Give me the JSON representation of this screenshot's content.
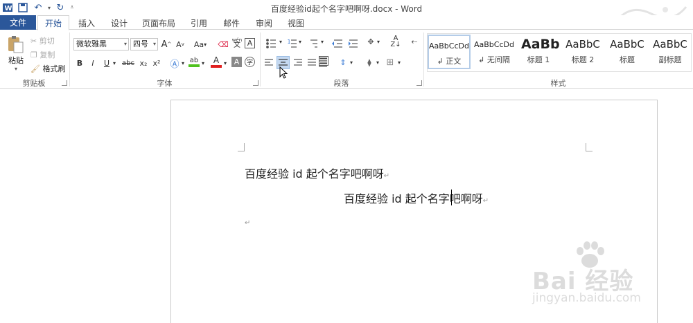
{
  "window": {
    "title": "百度经验id起个名字吧啊呀.docx - Word"
  },
  "tabs": {
    "file": "文件",
    "items": [
      "开始",
      "插入",
      "设计",
      "页面布局",
      "引用",
      "邮件",
      "审阅",
      "视图"
    ],
    "active": "开始"
  },
  "clipboard": {
    "paste": "粘贴",
    "cut": "剪切",
    "copy": "复制",
    "format_painter": "格式刷",
    "group_label": "剪贴板"
  },
  "font": {
    "name": "微软雅黑",
    "size": "四号",
    "group_label": "字体",
    "grow": "A",
    "shrink": "A",
    "case": "Aa",
    "bold": "B",
    "italic": "I",
    "underline": "U",
    "strike": "abc",
    "subscript": "x₂",
    "superscript": "x²",
    "font_color": "A",
    "shading": "A",
    "phonetic": "wén",
    "phonetic_sub": "文",
    "border_char": "A",
    "circle_char": "字"
  },
  "paragraph": {
    "group_label": "段落"
  },
  "styles": {
    "group_label": "样式",
    "items": [
      {
        "sample": "AaBbCcDd",
        "name": "↲ 正文"
      },
      {
        "sample": "AaBbCcDd",
        "name": "↲ 无间隔"
      },
      {
        "sample": "AaBb",
        "name": "标题 1"
      },
      {
        "sample": "AaBbC",
        "name": "标题 2"
      },
      {
        "sample": "AaBbC",
        "name": "标题"
      },
      {
        "sample": "AaBbC",
        "name": "副标题"
      }
    ]
  },
  "document": {
    "line1": "百度经验 id 起个名字吧啊呀",
    "line2": "百度经验 id 起个名字吧啊呀",
    "mark": "↵"
  },
  "watermark": {
    "brand": "Bai 经验",
    "url": "jingyan.baidu.com"
  },
  "colors": {
    "accent": "#2b579a",
    "highlight": "#f0c60a",
    "font_red": "#e02020",
    "highlight_green": "#4fc21e"
  }
}
